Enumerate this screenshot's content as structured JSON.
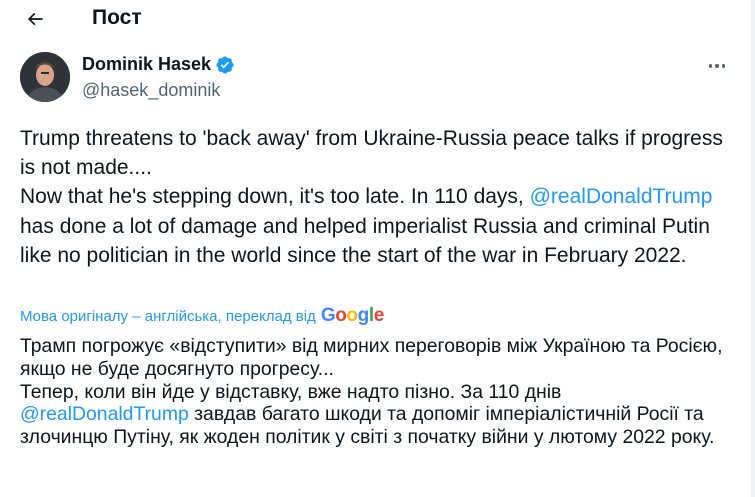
{
  "header": {
    "title": "Пост"
  },
  "tweet": {
    "author_name": "Dominik Hasek",
    "author_handle": "@hasek_dominik",
    "text_line1": "Trump threatens to 'back away' from Ukraine-Russia peace talks if progress is not made....",
    "text_line2": "Now that he's stepping down, it's too late. In 110 days, ",
    "mention": "@realDonaldTrump",
    "text_line3": " has done a lot of damage and helped imperialist Russia and criminal Putin like no politician in the world since the start of the war in February 2022."
  },
  "translation": {
    "note": "Мова оригіналу – англійська, переклад від",
    "provider": "Google",
    "line1": "Трамп погрожує «відступити» від мирних переговорів між Україною та Росією, якщо не буде досягнуто прогресу...",
    "line2": "Тепер, коли він йде у відставку, вже надто пізно. За 110 днів",
    "mention": "@realDonaldTrump",
    "line3": " завдав багато шкоди та допоміг імперіалістичній Росії та злочинцю Путіну, як жоден політик у світі з початку війни у лютому 2022 року."
  },
  "colors": {
    "accent": "#1d9bf0",
    "text": "#0f1419",
    "muted": "#536471"
  },
  "icons": {
    "back": "arrow-left-icon",
    "verified": "verified-badge-icon",
    "more": "more-dots-icon"
  }
}
